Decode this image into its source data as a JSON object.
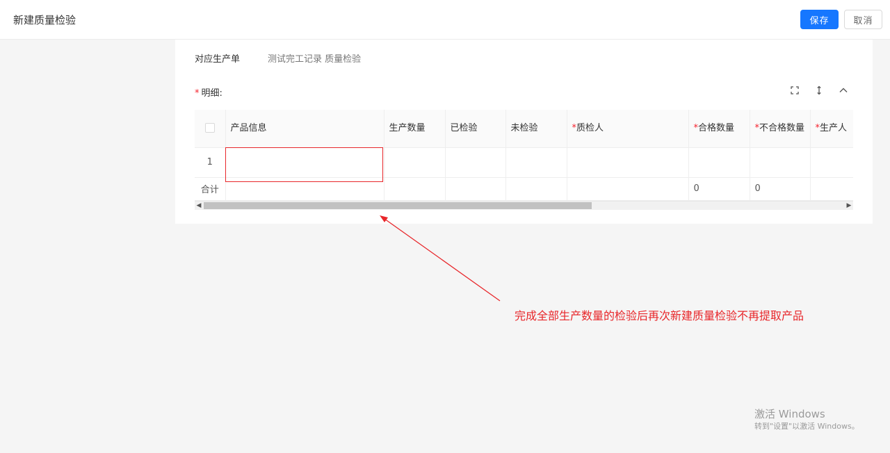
{
  "header": {
    "title": "新建质量检验",
    "save_label": "保存",
    "cancel_label": "取消"
  },
  "form": {
    "order_label": "对应生产单",
    "order_value": "测试完工记录 质量检验"
  },
  "detail": {
    "required_mark": "*",
    "title": "明细:",
    "tools": [
      "fullscreen-icon",
      "row-height-icon",
      "collapse-icon"
    ]
  },
  "table": {
    "columns": {
      "product": "产品信息",
      "produce_qty": "生产数量",
      "inspected": "已检验",
      "uninspected": "未检验",
      "inspector": "质检人",
      "qualified_qty": "合格数量",
      "unqualified_qty": "不合格数量",
      "producer": "生产人"
    },
    "required_mark": "*",
    "rows": [
      {
        "index": "1"
      }
    ],
    "summary": {
      "label": "合计",
      "qualified_qty": "0",
      "unqualified_qty": "0"
    }
  },
  "annotation": {
    "text": "完成全部生产数量的检验后再次新建质量检验不再提取产品",
    "color": "#e8262a"
  },
  "watermark": {
    "line1": "激活 Windows",
    "line2": "转到\"设置\"以激活 Windows。"
  },
  "colors": {
    "primary": "#1677ff",
    "danger": "#f5222d"
  }
}
